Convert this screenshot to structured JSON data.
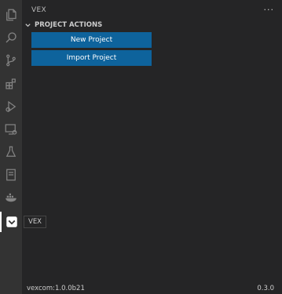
{
  "activity_bar": {
    "icons": [
      "explorer-icon",
      "search-icon",
      "source-control-icon",
      "extensions-icon",
      "run-debug-icon",
      "remote-explorer-icon",
      "testing-icon",
      "notebook-icon",
      "docker-icon",
      "vex-icon"
    ],
    "active": "vex-icon"
  },
  "sidebar": {
    "title": "VEX",
    "more_label": "···",
    "section": {
      "title": "PROJECT ACTIONS"
    },
    "buttons": {
      "new_project": "New Project",
      "import_project": "Import Project"
    }
  },
  "tooltip": {
    "text": "VEX"
  },
  "footer": {
    "left": "vexcom:1.0.0b21",
    "right": "0.3.0"
  },
  "colors": {
    "activity_bar_bg": "#333333",
    "sidebar_bg": "#252526",
    "button_bg": "#0e639c"
  }
}
